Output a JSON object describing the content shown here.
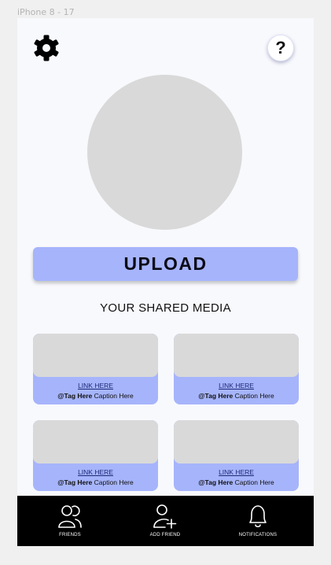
{
  "frame_label": "iPhone 8 - 17",
  "header": {
    "settings_icon": "gear-icon",
    "help_label": "?"
  },
  "profile": {
    "avatar_icon": "avatar-placeholder"
  },
  "upload_button": {
    "label": "UPLOAD",
    "color": "#a6b4fb"
  },
  "shared_media": {
    "title": "YOUR SHARED MEDIA",
    "items": [
      {
        "link": "LINK HERE",
        "tag": "@Tag Here",
        "caption": " Caption Here"
      },
      {
        "link": "LINK HERE",
        "tag": "@Tag Here",
        "caption": " Caption Here"
      },
      {
        "link": "LINK HERE",
        "tag": "@Tag Here",
        "caption": " Caption Here"
      },
      {
        "link": "LINK HERE",
        "tag": "@Tag Here",
        "caption": " Caption Here"
      }
    ]
  },
  "bottom_nav": {
    "items": [
      {
        "label": "FRIENDS",
        "icon": "friends-icon"
      },
      {
        "label": "ADD FRIEND",
        "icon": "add-friend-icon"
      },
      {
        "label": "NOTIFICATIONS",
        "icon": "bell-icon"
      }
    ]
  },
  "colors": {
    "accent": "#a6b4fb",
    "background": "#f8f9fd",
    "placeholder": "#d9d9d9",
    "navbar": "#000000"
  }
}
